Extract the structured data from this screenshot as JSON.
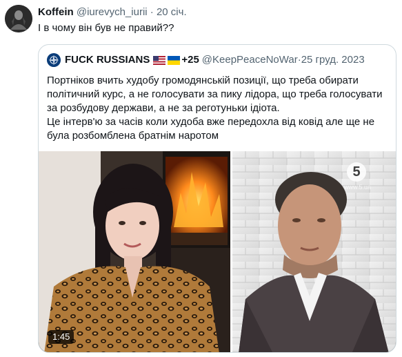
{
  "tweet": {
    "display_name": "Koffein",
    "handle": "@iurevych_iurii",
    "separator": "·",
    "time": "20 січ.",
    "text": "І в чому він був не правий??"
  },
  "quoted_tweet": {
    "display_name": "FUCK RUSSIANS",
    "name_suffix": "+25",
    "handle": "@KeepPeaceNoWar",
    "separator": "·",
    "time": "25 груд. 2023",
    "text_lines": [
      "Портніков вчить худобу громодянській позиції, що треба обирати політичний курс, а не голосувати за пику лідора, що треба голосувати за розбудову держави, а не за реготуньки ідіота.",
      "Це інтерв'ю за часів коли худоба вже передохла від ковід але ще не була розбомблена братнім наротом"
    ],
    "media": {
      "duration": "1:45",
      "channel_logo": "5",
      "channel_url": "www.5.ua"
    }
  },
  "colors": {
    "text_primary": "#0f1419",
    "text_secondary": "#536471",
    "border": "#cfd9de"
  },
  "icons": {
    "quoted_avatar": "nato-star-icon",
    "flag_1": "us-flag-icon",
    "flag_2": "ukraine-flag-icon"
  }
}
